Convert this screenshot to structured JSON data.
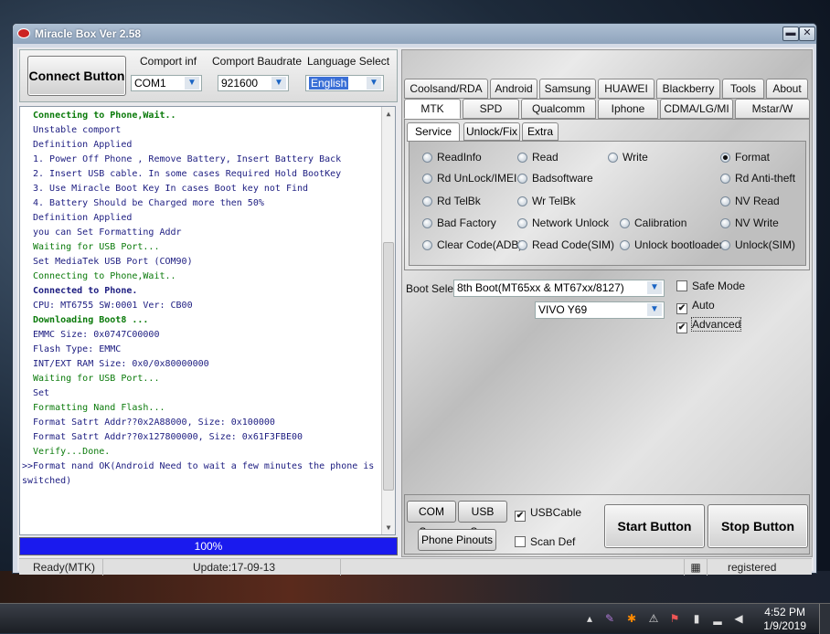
{
  "window": {
    "title": "Miracle Box Ver 2.58",
    "minimize_glyph": "▬",
    "close_glyph": "✕"
  },
  "top": {
    "connect_label": "Connect Button",
    "comport_label": "Comport inf",
    "comport_value": "COM1",
    "baud_label": "Comport Baudrate",
    "baud_value": "921600",
    "lang_label": "Language Select",
    "lang_value": "English"
  },
  "log": [
    {
      "text": "Connecting to Phone,Wait..",
      "style": "gb"
    },
    {
      "text": "Unstable comport",
      "style": "n"
    },
    {
      "text": "Definition Applied",
      "style": "n"
    },
    {
      "text": "1. Power Off Phone , Remove Battery, Insert Battery Back",
      "style": "n"
    },
    {
      "text": "2. Insert USB cable. In some cases Required Hold BootKey",
      "style": "n"
    },
    {
      "text": "3. Use Miracle Boot Key In cases Boot key not Find",
      "style": "n"
    },
    {
      "text": "4. Battery Should be Charged more then 50%",
      "style": "n"
    },
    {
      "text": "Definition Applied",
      "style": "n"
    },
    {
      "text": "you can Set Formatting Addr",
      "style": "n"
    },
    {
      "text": "Waiting for USB Port...",
      "style": "g"
    },
    {
      "text": "Set MediaTek USB Port (COM90)",
      "style": "n"
    },
    {
      "text": "Connecting to Phone,Wait..",
      "style": "g"
    },
    {
      "text": "Connected to Phone.",
      "style": "b"
    },
    {
      "text": "CPU: MT6755 SW:0001 Ver: CB00",
      "style": "n"
    },
    {
      "text": "Downloading Boot8 ...",
      "style": "gb"
    },
    {
      "text": "EMMC Size: 0x0747C00000",
      "style": "n"
    },
    {
      "text": "Flash Type: EMMC",
      "style": "n"
    },
    {
      "text": "INT/EXT RAM  Size: 0x0/0x80000000",
      "style": "n"
    },
    {
      "text": "Waiting for USB Port...",
      "style": "g"
    },
    {
      "text": "Set",
      "style": "n"
    },
    {
      "text": "Formatting Nand Flash...",
      "style": "g"
    },
    {
      "text": "Format Satrt Addr??0x2A88000, Size: 0x100000",
      "style": "n"
    },
    {
      "text": "Format Satrt Addr??0x127800000, Size: 0x61F3FBE00",
      "style": "n"
    },
    {
      "text": "Verify...Done.",
      "style": "g"
    },
    {
      "text": ">>Format nand OK(Android Need to wait a few minutes the phone is",
      "style": "n"
    },
    {
      "text": "switched)",
      "style": "n"
    }
  ],
  "progress": {
    "label": "100%",
    "value": 100
  },
  "status": {
    "mode": "Ready(MTK)",
    "update": "Update:17-09-13",
    "registered": "registered"
  },
  "tabs_row1": [
    "Coolsand/RDA",
    "Android",
    "Samsung",
    "HUAWEI",
    "Blackberry",
    "Tools",
    "About"
  ],
  "tabs_row2": [
    "MTK",
    "SPD",
    "Qualcomm",
    "Iphone",
    "CDMA/LG/MI",
    "Mstar/W"
  ],
  "subtabs": [
    "Service",
    "Unlock/Fix",
    "Extra"
  ],
  "radios": [
    [
      "ReadInfo",
      "Read",
      "Write",
      "Format"
    ],
    [
      "Rd UnLock/IMEI",
      "Badsoftware",
      "",
      "Rd Anti-theft"
    ],
    [
      "Rd TelBk",
      "Wr TelBk",
      "",
      "NV Read"
    ],
    [
      "Bad Factory",
      "Network Unlock",
      "Calibration",
      "NV Write"
    ],
    [
      "Clear Code(ADB)",
      "Read Code(SIM)",
      "Unlock bootloader",
      "Unlock(SIM)"
    ]
  ],
  "selected_radio": "Format",
  "boot": {
    "label": "Boot Selec",
    "value": "8th Boot(MT65xx & MT67xx/8127)",
    "model_value": "VIVO Y69"
  },
  "options": [
    {
      "label": "Safe Mode",
      "checked": false
    },
    {
      "label": "Auto",
      "checked": true
    },
    {
      "label": "Advanced",
      "checked": true
    }
  ],
  "bottom": {
    "com_scan": "COM Scan",
    "usb_scan": "USB Scan",
    "usb_cable": "USBCable",
    "usb_cable_checked": true,
    "phone_pinouts": "Phone Pinouts",
    "scan_def": "Scan Def",
    "scan_def_checked": false,
    "start": "Start Button",
    "stop": "Stop Button"
  },
  "taskbar": {
    "time": "4:52 PM",
    "date": "1/9/2019"
  }
}
